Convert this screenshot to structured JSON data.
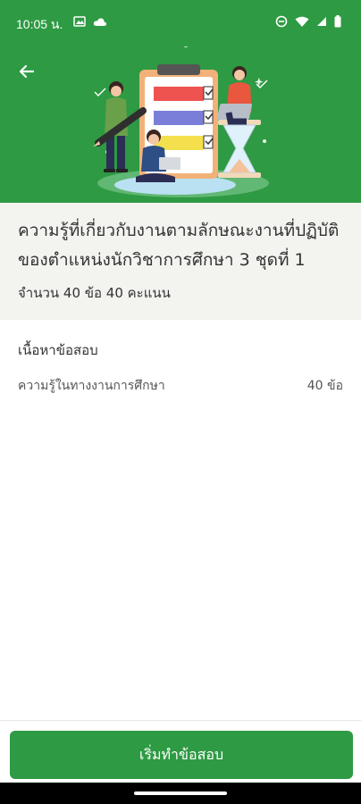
{
  "status": {
    "time": "10:05 น."
  },
  "header": {
    "back_icon": "arrow-left-icon"
  },
  "exam": {
    "title": "ความรู้ที่เกี่ยวกับงานตามลักษณะงานที่ปฏิบัติของตำแหน่งนักวิชาการศึกษา 3 ชุดที่ 1",
    "summary": "จำนวน 40 ข้อ 40 คะแนน"
  },
  "content": {
    "heading": "เนื้อหาข้อสอบ",
    "items": [
      {
        "label": "ความรู้ในทางงานการศึกษา",
        "count": "40 ข้อ"
      }
    ]
  },
  "actions": {
    "start_label": "เริ่มทำข้อสอบ"
  },
  "colors": {
    "primary": "#2e9a43",
    "title_bg": "#f3f3f0"
  }
}
